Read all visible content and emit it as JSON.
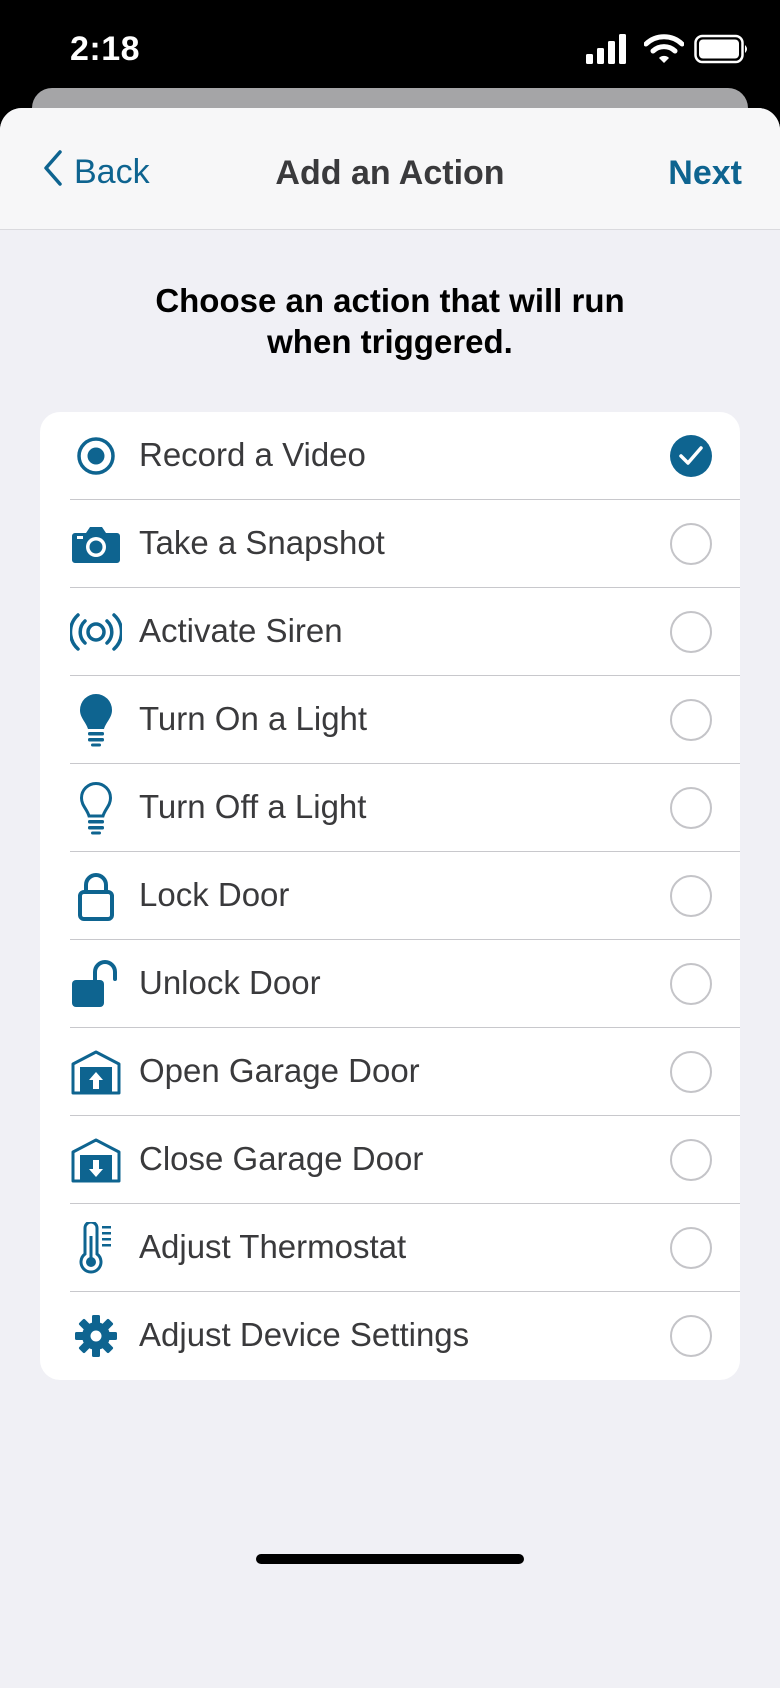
{
  "status_bar": {
    "time": "2:18",
    "icons": [
      "cellular-signal-icon",
      "wifi-icon",
      "battery-icon"
    ]
  },
  "nav": {
    "back_label": "Back",
    "title": "Add an Action",
    "next_label": "Next"
  },
  "prompt": "Choose an action that will run when triggered.",
  "colors": {
    "accent": "#0e6490",
    "sheet_background": "#f0f0f5",
    "radio_border": "#c4c4c8"
  },
  "actions": [
    {
      "label": "Record a Video",
      "icon": "record-icon",
      "selected": true
    },
    {
      "label": "Take a Snapshot",
      "icon": "camera-icon",
      "selected": false
    },
    {
      "label": "Activate Siren",
      "icon": "siren-icon",
      "selected": false
    },
    {
      "label": "Turn On a Light",
      "icon": "light-bulb-on-icon",
      "selected": false
    },
    {
      "label": "Turn Off a Light",
      "icon": "light-bulb-off-icon",
      "selected": false
    },
    {
      "label": "Lock Door",
      "icon": "lock-icon",
      "selected": false
    },
    {
      "label": "Unlock Door",
      "icon": "unlock-icon",
      "selected": false
    },
    {
      "label": "Open Garage Door",
      "icon": "garage-open-icon",
      "selected": false
    },
    {
      "label": "Close Garage Door",
      "icon": "garage-close-icon",
      "selected": false
    },
    {
      "label": "Adjust Thermostat",
      "icon": "thermostat-icon",
      "selected": false
    },
    {
      "label": "Adjust Device Settings",
      "icon": "gear-icon",
      "selected": false
    }
  ]
}
